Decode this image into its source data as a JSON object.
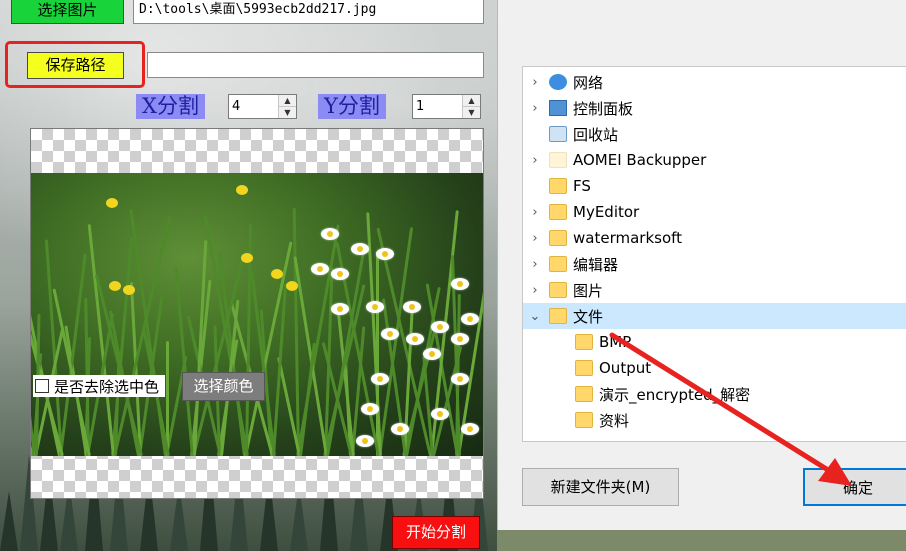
{
  "app": {
    "select_image_label": "选择图片",
    "image_path": "D:\\tools\\桌面\\5993ecb2dd217.jpg",
    "save_path_label": "保存路径",
    "save_path_value": "",
    "x_split_label": "X分割",
    "x_split_value": "4",
    "y_split_label": "Y分割",
    "y_split_value": "1",
    "remove_color_label": "是否去除选中色",
    "choose_color_label": "选择颜色",
    "start_split_label": "开始分割"
  },
  "dialog": {
    "tree": [
      {
        "label": "网络",
        "icon": "network-icon",
        "expand": ">",
        "indent": 0
      },
      {
        "label": "控制面板",
        "icon": "control-panel-icon",
        "expand": ">",
        "indent": 0
      },
      {
        "label": "回收站",
        "icon": "recycle-bin-icon",
        "expand": "",
        "indent": 0
      },
      {
        "label": "AOMEI Backupper",
        "icon": "folder-icon",
        "expand": ">",
        "indent": 0
      },
      {
        "label": "FS",
        "icon": "folder-icon",
        "expand": "",
        "indent": 0
      },
      {
        "label": "MyEditor",
        "icon": "folder-icon",
        "expand": ">",
        "indent": 0
      },
      {
        "label": "watermarksoft",
        "icon": "folder-icon",
        "expand": ">",
        "indent": 0
      },
      {
        "label": "编辑器",
        "icon": "folder-icon",
        "expand": ">",
        "indent": 0
      },
      {
        "label": "图片",
        "icon": "folder-icon",
        "expand": ">",
        "indent": 0
      },
      {
        "label": "文件",
        "icon": "folder-icon",
        "expand": "v",
        "indent": 0
      },
      {
        "label": "BMP",
        "icon": "folder-icon",
        "expand": "",
        "indent": 1
      },
      {
        "label": "Output",
        "icon": "folder-icon",
        "expand": "",
        "indent": 1
      },
      {
        "label": "演示_encrypted_解密",
        "icon": "folder-icon",
        "expand": "",
        "indent": 1
      },
      {
        "label": "资料",
        "icon": "folder-icon",
        "expand": "",
        "indent": 1
      }
    ],
    "new_folder_label": "新建文件夹(M)",
    "ok_label": "确定"
  },
  "colors": {
    "select_button": "#19d33b",
    "save_button": "#f5ff1e",
    "start_button": "#f80f0f",
    "highlight_box": "#e8231f",
    "annotation_arrow": "#e8231f",
    "tree_selected": "#cce8ff"
  }
}
